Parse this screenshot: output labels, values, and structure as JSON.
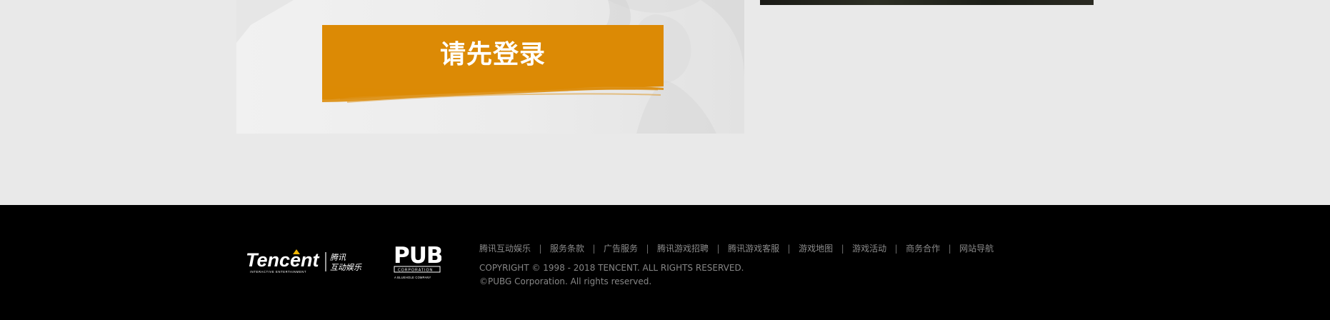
{
  "login": {
    "button_label": "请先登录"
  },
  "colors": {
    "page_bg": "#e8e8e8",
    "panel_bg": "#efefef",
    "accent": "#dc8a05",
    "footer_bg": "#000000",
    "footer_text": "#8a8a8a"
  },
  "footer": {
    "links": [
      {
        "label": "腾讯互动娱乐"
      },
      {
        "label": "服务条款"
      },
      {
        "label": "广告服务"
      },
      {
        "label": "腾讯游戏招聘"
      },
      {
        "label": "腾讯游戏客服"
      },
      {
        "label": "游戏地图"
      },
      {
        "label": "游戏活动"
      },
      {
        "label": "商务合作"
      },
      {
        "label": "网站导航"
      }
    ],
    "separator": "|",
    "copyright": "COPYRIGHT © 1998 - 2018 TENCENT. ALL RIGHTS RESERVED.",
    "pubg_rights": "©PUBG Corporation. All rights reserved.",
    "tencent_logo": {
      "wordmark": "Tencent",
      "chinese_1": "腾讯",
      "chinese_2": "互动娱乐",
      "tagline": "INTERACTIVE ENTERTAINMENT"
    },
    "pubg_logo": {
      "wordmark": "PUBG",
      "subtext": "CORPORATION",
      "tagline": "A BLUEHOLE COMPANY"
    }
  }
}
